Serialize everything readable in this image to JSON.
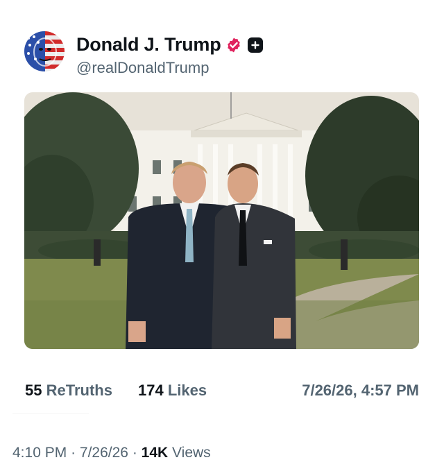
{
  "post": {
    "author_name": "Donald J. Trump",
    "author_handle": "@realDonaldTrump",
    "image_alt": "Two men in suits standing on the lawn in front of the White House"
  },
  "stats": {
    "retruths_count": "55",
    "retruths_label": "ReTruths",
    "likes_count": "174",
    "likes_label": "Likes",
    "date": "7/26/26, 4:57 PM"
  },
  "meta": {
    "time": "4:10 PM",
    "sep1": "·",
    "date": "7/26/26",
    "sep2": "·",
    "views_count": "14K",
    "views_label": "Views"
  },
  "colors": {
    "text_primary": "#0f1419",
    "text_secondary": "#536471",
    "verified_badge": "#e0245e"
  },
  "icons": {
    "verified": "verified-badge-icon",
    "follow": "plus-icon"
  }
}
